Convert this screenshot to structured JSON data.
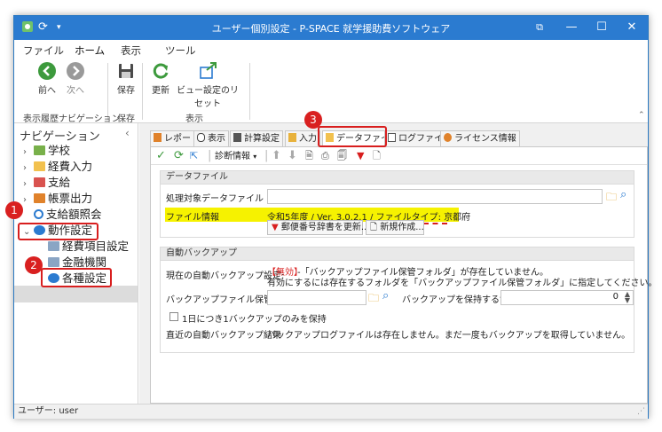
{
  "window": {
    "title": "ユーザー個別設定 - P-SPACE 就学援助費ソフトウェア",
    "controls": {
      "restore": "⧉",
      "minimize": "—",
      "maximize": "☐",
      "close": "✕"
    }
  },
  "menu": {
    "items": [
      "ファイル",
      "ホーム",
      "表示",
      "ツール"
    ],
    "active": "ホーム"
  },
  "ribbon": {
    "buttons": {
      "back": "前へ",
      "forward": "次へ",
      "save": "保存",
      "refresh": "更新",
      "reset_view": "ビュー設定のリセット"
    },
    "groups": {
      "history_nav": "表示履歴ナビゲーション",
      "save": "保存",
      "view": "表示"
    }
  },
  "nav": {
    "title": "ナビゲーション",
    "collapse": "‹",
    "items": {
      "school": "学校",
      "budget_input": "経費入力",
      "payment": "支給",
      "ledger_output": "帳票出力",
      "payment_inquiry": "支給額照会",
      "operation_settings": "動作設定",
      "expense_items": "経費項目設定",
      "financial_institutions": "金融機関",
      "various_settings": "各種設定"
    }
  },
  "tabs": [
    "レポート",
    "表示",
    "計算設定",
    "入力",
    "データファイル",
    "ログファイル",
    "ライセンス情報"
  ],
  "toolbar": {
    "diagnostic": "診断情報"
  },
  "data_file": {
    "header": "データファイル",
    "target_label": "処理対象データファイル",
    "info_label": "ファイル情報",
    "info_value": "令和5年度 / Ver. 3.0.2.1 / ファイルタイプ: 京都府",
    "postal_button": "郵便番号辞書を更新...",
    "new_button": "新規作成..."
  },
  "auto_backup": {
    "header": "自動バックアップ",
    "current_label": "現在の自動バックアップ設定:",
    "status_invalid": "【無効】",
    "status_msg1": "-「バックアップファイル保管フォルダ」が存在していません。",
    "status_msg2": "有効にするには存在するフォルダを「バックアップファイル保管フォルダ」に指定してください。",
    "folder_label": "バックアップファイル保管フォルダ",
    "generations_label": "バックアップを保持する世代数",
    "generations_value": "0",
    "daily_checkbox": "1日につき1バックアップのみを保持",
    "recent_label": "直近の自動バックアップ結果",
    "recent_value": "バックアップログファイルは存在しません。まだ一度もバックアップを取得していません。"
  },
  "status": {
    "user": "ユーザー: user"
  },
  "markers": {
    "m1": "1",
    "m2": "2",
    "m3": "3"
  },
  "colors": {
    "titlebar": "#2b7bd0",
    "highlight": "#f6f200",
    "annotation": "#d81e1e"
  }
}
